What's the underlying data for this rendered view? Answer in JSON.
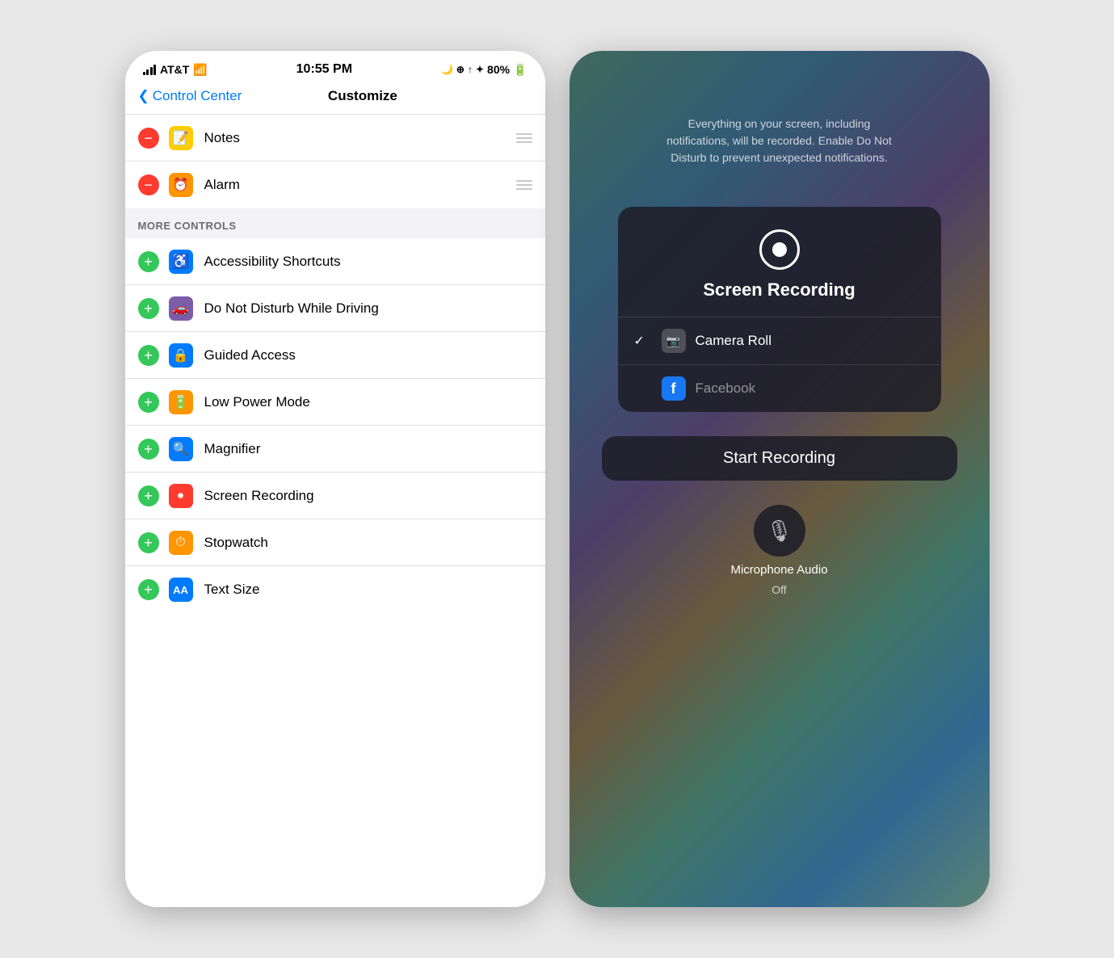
{
  "left_phone": {
    "status_bar": {
      "carrier": "AT&T",
      "time": "10:55 PM",
      "battery": "80%"
    },
    "nav": {
      "back_label": "Control Center",
      "title": "Customize"
    },
    "included_items": [
      {
        "id": "notes",
        "label": "Notes",
        "icon_type": "notes",
        "icon_color": "yellow"
      },
      {
        "id": "alarm",
        "label": "Alarm",
        "icon_type": "alarm",
        "icon_color": "orange_clock"
      }
    ],
    "section_header": "MORE CONTROLS",
    "more_controls": [
      {
        "id": "accessibility",
        "label": "Accessibility Shortcuts",
        "icon_type": "accessibility",
        "icon_color": "blue_access"
      },
      {
        "id": "dnd_driving",
        "label": "Do Not Disturb While Driving",
        "icon_type": "car",
        "icon_color": "purple"
      },
      {
        "id": "guided_access",
        "label": "Guided Access",
        "icon_type": "lock",
        "icon_color": "blue_lock"
      },
      {
        "id": "low_power",
        "label": "Low Power Mode",
        "icon_type": "battery",
        "icon_color": "orange_power"
      },
      {
        "id": "magnifier",
        "label": "Magnifier",
        "icon_type": "magnifier",
        "icon_color": "blue_magnifier"
      },
      {
        "id": "screen_recording",
        "label": "Screen Recording",
        "icon_type": "record",
        "icon_color": "red"
      },
      {
        "id": "stopwatch",
        "label": "Stopwatch",
        "icon_type": "stopwatch",
        "icon_color": "orange_stop"
      },
      {
        "id": "text_size",
        "label": "Text Size",
        "icon_type": "text",
        "icon_color": "blue_aa"
      }
    ]
  },
  "right_phone": {
    "warning_text": "Everything on your screen, including notifications, will be recorded. Enable Do Not Disturb to prevent unexpected notifications.",
    "title": "Screen Recording",
    "options": [
      {
        "id": "camera_roll",
        "label": "Camera Roll",
        "checked": true
      },
      {
        "id": "facebook",
        "label": "Facebook",
        "checked": false
      }
    ],
    "start_button": "Start Recording",
    "microphone": {
      "label": "Microphone Audio",
      "sublabel": "Off"
    }
  }
}
